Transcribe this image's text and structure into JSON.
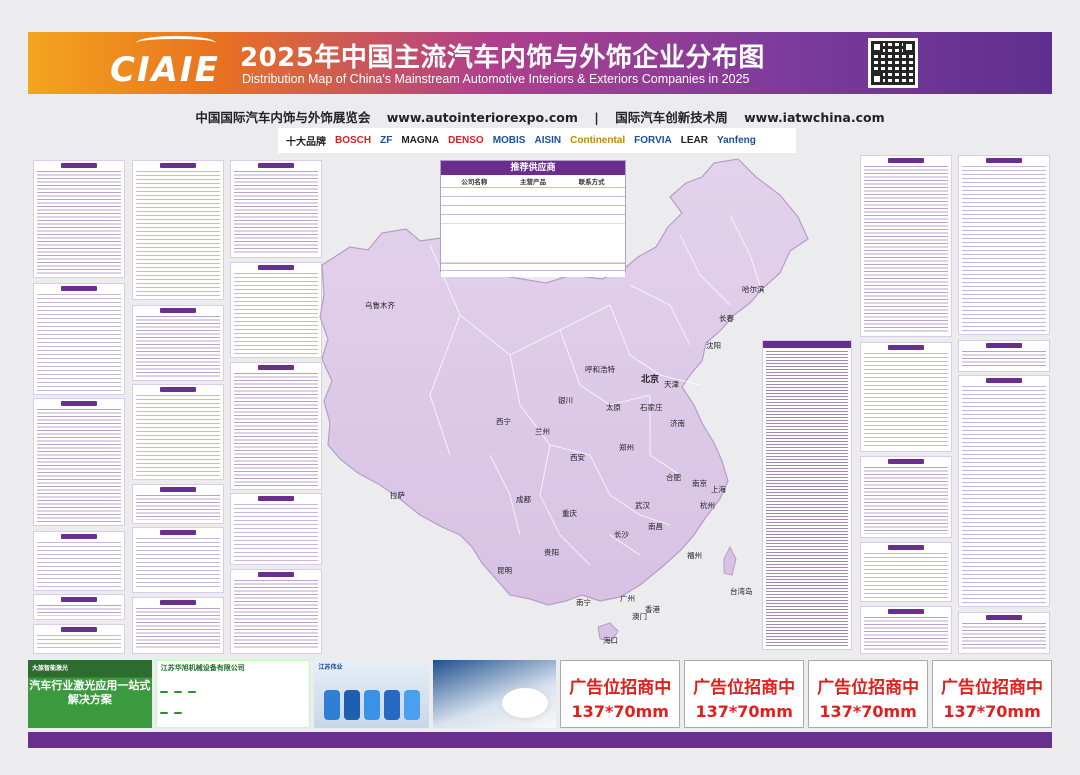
{
  "header": {
    "logo": "CIAIE",
    "title_cn": "2025年中国主流汽车内饰与外饰企业分布图",
    "title_en": "Distribution Map of China's Mainstream Automotive Interiors & Exteriors Companies in 2025"
  },
  "expo_line": {
    "expo_name": "中国国际汽车内饰与外饰展览会",
    "expo_url": "www.autointeriorexpo.com",
    "separator": "|",
    "week_name": "国际汽车创新技术周",
    "week_url": "www.iatwchina.com"
  },
  "brands": [
    {
      "label": "十大品牌",
      "color": "#222222"
    },
    {
      "label": "BOSCH",
      "color": "#d61f26"
    },
    {
      "label": "ZF",
      "color": "#1b4f9c"
    },
    {
      "label": "MAGNA",
      "color": "#222222"
    },
    {
      "label": "DENSO",
      "color": "#d61f26"
    },
    {
      "label": "MOBIS",
      "color": "#1b4f9c"
    },
    {
      "label": "AISIN",
      "color": "#1b4f9c"
    },
    {
      "label": "Continental",
      "color": "#c48a00"
    },
    {
      "label": "FORVIA",
      "color": "#1b4f9c"
    },
    {
      "label": "LEAR",
      "color": "#222222"
    },
    {
      "label": "Yanfeng",
      "color": "#1b4f9c"
    }
  ],
  "supplier": {
    "title": "推荐供应商",
    "columns": [
      "公司名称",
      "主营产品",
      "联系方式"
    ]
  },
  "cities": [
    {
      "name": "乌鲁木齐"
    },
    {
      "name": "哈尔滨"
    },
    {
      "name": "长春"
    },
    {
      "name": "沈阳"
    },
    {
      "name": "呼和浩特"
    },
    {
      "name": "北京"
    },
    {
      "name": "天津"
    },
    {
      "name": "银川"
    },
    {
      "name": "太原"
    },
    {
      "name": "石家庄"
    },
    {
      "name": "济南"
    },
    {
      "name": "西宁"
    },
    {
      "name": "兰州"
    },
    {
      "name": "郑州"
    },
    {
      "name": "西安"
    },
    {
      "name": "合肥"
    },
    {
      "name": "南京"
    },
    {
      "name": "上海"
    },
    {
      "name": "拉萨"
    },
    {
      "name": "成都"
    },
    {
      "name": "武汉"
    },
    {
      "name": "杭州"
    },
    {
      "name": "重庆"
    },
    {
      "name": "长沙"
    },
    {
      "name": "南昌"
    },
    {
      "name": "贵阳"
    },
    {
      "name": "福州"
    },
    {
      "name": "台湾岛"
    },
    {
      "name": "昆明"
    },
    {
      "name": "南宁"
    },
    {
      "name": "广州"
    },
    {
      "name": "香港"
    },
    {
      "name": "澳门"
    },
    {
      "name": "海口"
    }
  ],
  "ads": {
    "ad1_top": "大族智能激光",
    "ad1_big": "汽车行业激光应用一站式解决方案",
    "ad2_title": "江苏华旭机械设备有限公司",
    "ad3_title": "江苏伟业",
    "slot_l1": "广告位招商中",
    "slot_l2": "137*70mm"
  }
}
